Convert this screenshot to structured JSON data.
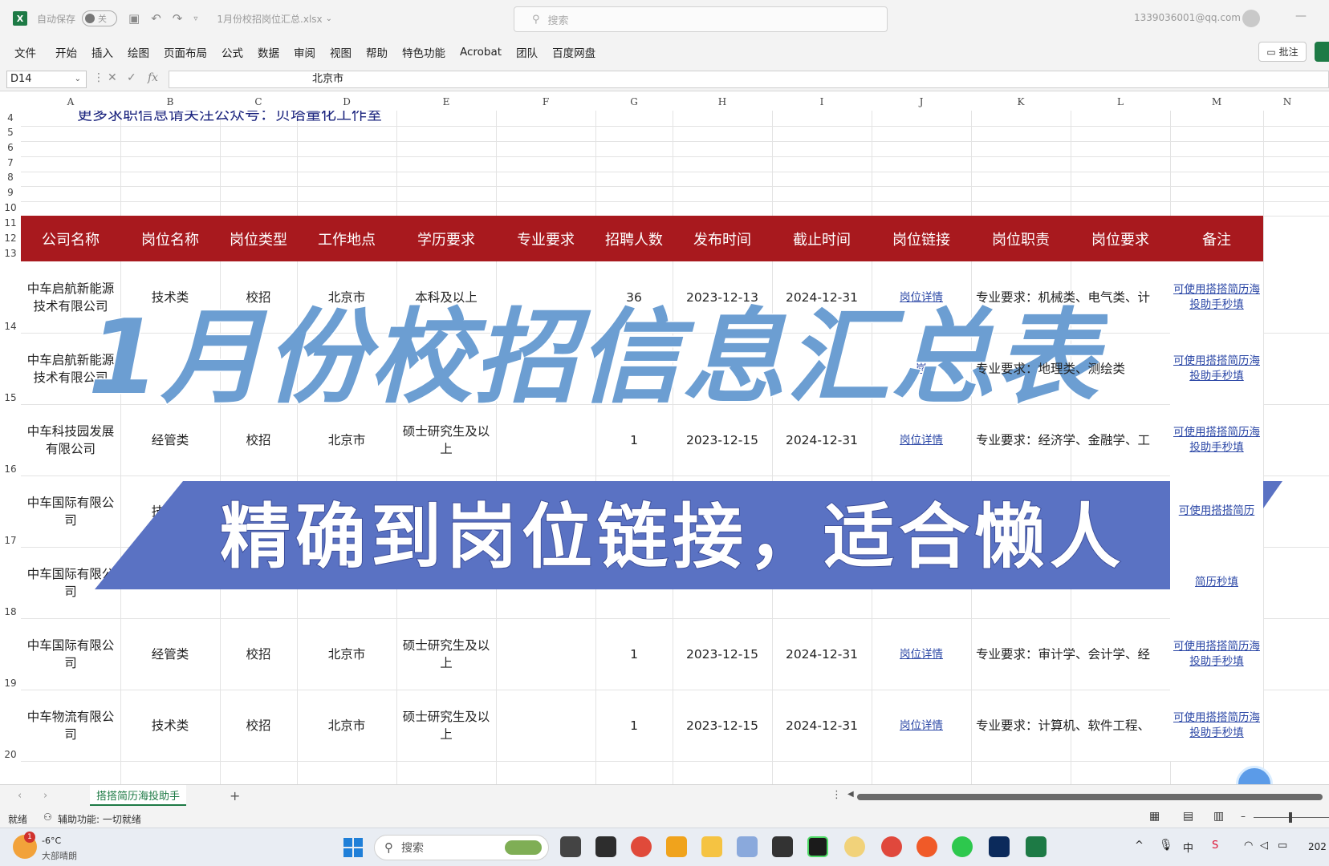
{
  "titlebar": {
    "autosave_label": "自动保存",
    "autosave_state": "关",
    "filename": "1月份校招岗位汇总.xlsx",
    "search_placeholder": "搜索",
    "account": "1339036001@qq.com"
  },
  "ribbon": {
    "tabs": [
      "文件",
      "开始",
      "插入",
      "绘图",
      "页面布局",
      "公式",
      "数据",
      "审阅",
      "视图",
      "帮助",
      "特色功能",
      "Acrobat",
      "团队",
      "百度网盘"
    ],
    "comment_button": "批注"
  },
  "formula_bar": {
    "cell_ref": "D14",
    "fx": "fx",
    "value": "北京市"
  },
  "columns": [
    "A",
    "B",
    "C",
    "D",
    "E",
    "F",
    "G",
    "H",
    "I",
    "J",
    "K",
    "L",
    "M",
    "N"
  ],
  "rows": [
    "4",
    "5",
    "6",
    "7",
    "8",
    "9",
    "10",
    "11",
    "12",
    "13",
    "14",
    "15",
    "16",
    "17",
    "18",
    "19",
    "20"
  ],
  "promo_text": "更多求职信息请关注公众号：贝塔量化工作室",
  "table_headers": [
    "公司名称",
    "岗位名称",
    "岗位类型",
    "工作地点",
    "学历要求",
    "专业要求",
    "招聘人数",
    "发布时间",
    "截止时间",
    "岗位链接",
    "岗位职责",
    "岗位要求",
    "备注"
  ],
  "table_rows": [
    {
      "company": "中车启航新能源技术有限公司",
      "position": "技术类",
      "type": "校招",
      "location": "北京市",
      "education": "本科及以上",
      "major": "",
      "count": "36",
      "publish": "2023-12-13",
      "deadline": "2024-12-31",
      "link": "岗位详情",
      "duty": "专业要求：机械类、电气类、计",
      "req": "",
      "note": "可使用搭搭简历海投助手秒填"
    },
    {
      "company": "中车启航新能源技术有限公司",
      "position": "",
      "type": "",
      "location": "",
      "education": "",
      "major": "",
      "count": "",
      "publish": "",
      "deadline": "",
      "link": "岗",
      "duty": "专业要求：地理类、测绘类",
      "req": "",
      "note": "可使用搭搭简历海投助手秒填"
    },
    {
      "company": "中车科技园发展有限公司",
      "position": "经管类",
      "type": "校招",
      "location": "北京市",
      "education": "硕士研究生及以上",
      "major": "",
      "count": "1",
      "publish": "2023-12-15",
      "deadline": "2024-12-31",
      "link": "岗位详情",
      "duty": "专业要求：经济学、金融学、工",
      "req": "",
      "note": "可使用搭搭简历海投助手秒填"
    },
    {
      "company": "中车国际有限公司",
      "position": "技术类",
      "type": "",
      "location": "",
      "education": "",
      "major": "",
      "count": "",
      "publish": "",
      "deadline": "",
      "link": "",
      "duty": "",
      "req": "",
      "note": "可使用搭搭简历"
    },
    {
      "company": "中车国际有限公司",
      "position": "",
      "type": "",
      "location": "",
      "education": "",
      "major": "",
      "count": "",
      "publish": "",
      "deadline": "",
      "link": "",
      "duty": "",
      "req": "",
      "note": "简历秒填"
    },
    {
      "company": "中车国际有限公司",
      "position": "经管类",
      "type": "校招",
      "location": "北京市",
      "education": "硕士研究生及以上",
      "major": "",
      "count": "1",
      "publish": "2023-12-15",
      "deadline": "2024-12-31",
      "link": "岗位详情",
      "duty": "专业要求：审计学、会计学、经",
      "req": "",
      "note": "可使用搭搭简历海投助手秒填"
    },
    {
      "company": "中车物流有限公司",
      "position": "技术类",
      "type": "校招",
      "location": "北京市",
      "education": "硕士研究生及以上",
      "major": "",
      "count": "1",
      "publish": "2023-12-15",
      "deadline": "2024-12-31",
      "link": "岗位详情",
      "duty": "专业要求：计算机、软件工程、",
      "req": "",
      "note": "可使用搭搭简历海投助手秒填"
    }
  ],
  "overlay": {
    "title": "1月份校招信息汇总表",
    "subtitle": "精确到岗位链接，适合懒人"
  },
  "sheet_tabs": [
    "搭搭简历海投助手"
  ],
  "status": {
    "ready": "就绪",
    "accessibility": "辅助功能: 一切就绪"
  },
  "taskbar": {
    "weather_temp": "-6°C",
    "weather_desc": "大部晴朗",
    "search_label": "搜索",
    "clock_partial": "202",
    "notification_count": "1"
  },
  "colors": {
    "header_red": "#a8191e",
    "title_blue": "#6c9ed2",
    "banner_blue": "#5a72c3",
    "excel_green": "#1d7a45"
  }
}
